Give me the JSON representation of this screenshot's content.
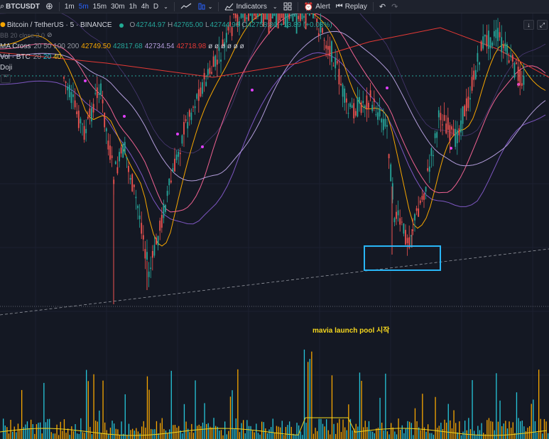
{
  "toolbar": {
    "symbol": "BTCUSDT",
    "timeframes": [
      {
        "label": "1m",
        "active": false
      },
      {
        "label": "5m",
        "active": true
      },
      {
        "label": "15m",
        "active": false
      },
      {
        "label": "30m",
        "active": false
      },
      {
        "label": "1h",
        "active": false
      },
      {
        "label": "4h",
        "active": false
      },
      {
        "label": "D",
        "active": false
      }
    ],
    "indicators_label": "Indicators",
    "alert_label": "Alert",
    "replay_label": "Replay"
  },
  "legend": {
    "title": "Bitcoin / TetherUS · 5 · BINANCE",
    "open_label": "O",
    "open": "42744.97",
    "high_label": "H",
    "high": "42765.00",
    "low_label": "L",
    "low": "42744.96",
    "close_label": "C",
    "close": "42758.86",
    "change": "+13.89 (+0.03%)",
    "bb_settings": "BB 20 close 2 0",
    "ma_name": "MA Cross",
    "ma_settings": "20 50 100 200",
    "ma_values": [
      "42749.50",
      "42817.68",
      "42734.54",
      "42718.98"
    ],
    "ma_empty": "ø ø ø ø ø ø",
    "vol_name": "Vol · BTC",
    "vol_settings": "20",
    "vol_v1": "20",
    "vol_v2": "40",
    "doji_name": "Doji"
  },
  "annotation": "mavia launch pool 시작",
  "colors": {
    "background": "#141823",
    "up": "#26a69a",
    "down": "#ef5350",
    "ma20": "#f7a600",
    "ma50": "#f06292",
    "ma100": "#b39ddb",
    "ma200": "#e53935",
    "bb": "#7e57c2",
    "price_line": "#26a69a",
    "highlight_box": "#29b6f6",
    "volume_up": "#26c6da",
    "volume_down": "#f7a600",
    "volume_ma": "#f5d71e",
    "annotation": "#f5d71e"
  },
  "icons": [
    "symbol-icon",
    "add-symbol-icon",
    "chart-style-icon",
    "bars-style-icon",
    "chevron-down-icon",
    "indicators-icon",
    "templates-icon",
    "alert-icon",
    "replay-icon",
    "undo-icon",
    "redo-icon",
    "eye-icon",
    "arrow-down-icon",
    "collapse-icon",
    "maximize-icon"
  ]
}
